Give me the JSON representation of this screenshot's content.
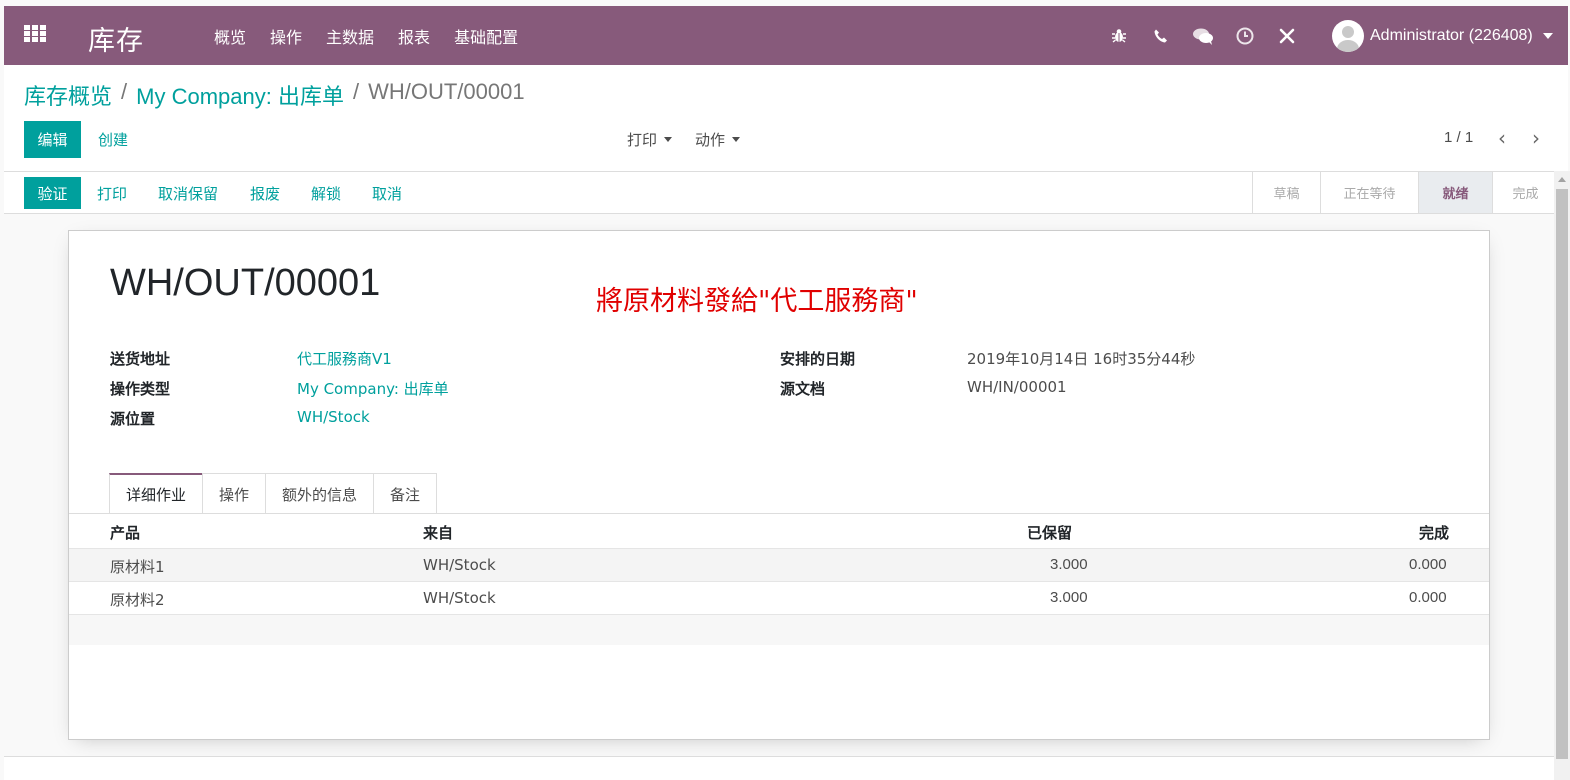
{
  "navbar": {
    "app_name": "库存",
    "menu": [
      "概览",
      "操作",
      "主数据",
      "报表",
      "基础配置"
    ],
    "user": "Administrator (226408)",
    "icons": [
      "bug-icon",
      "phone-icon",
      "chat-icon",
      "clock-icon",
      "tools-icon"
    ]
  },
  "breadcrumb": {
    "items": [
      "库存概览",
      "My Company: 出库单"
    ],
    "current": "WH/OUT/00001"
  },
  "control": {
    "edit": "编辑",
    "create": "创建",
    "print": "打印",
    "action": "动作",
    "pager": "1 / 1"
  },
  "statusbar": {
    "validate": "验证",
    "buttons": [
      "打印",
      "取消保留",
      "报废",
      "解锁",
      "取消"
    ],
    "stages": [
      "草稿",
      "正在等待",
      "就绪",
      "完成"
    ],
    "active_stage": "就绪"
  },
  "record": {
    "title": "WH/OUT/00001",
    "annotation": "將原材料發給\"代工服務商\"",
    "fields_left": [
      {
        "label": "送货地址",
        "value": "代工服務商V1"
      },
      {
        "label": "操作类型",
        "value": "My Company: 出库单"
      },
      {
        "label": "源位置",
        "value": "WH/Stock"
      }
    ],
    "fields_right": [
      {
        "label": "安排的日期",
        "value": "2019年10月14日 16时35分44秒"
      },
      {
        "label": "源文档",
        "value": "WH/IN/00001"
      }
    ]
  },
  "tabs": [
    "详细作业",
    "操作",
    "额外的信息",
    "备注"
  ],
  "table": {
    "headers": [
      "产品",
      "来自",
      "已保留",
      "完成"
    ],
    "rows": [
      [
        "原材料1",
        "WH/Stock",
        "3.000",
        "0.000"
      ],
      [
        "原材料2",
        "WH/Stock",
        "3.000",
        "0.000"
      ]
    ]
  },
  "colors": {
    "brand": "#875a7b",
    "accent": "#00a09d",
    "annotation": "#e00000"
  }
}
